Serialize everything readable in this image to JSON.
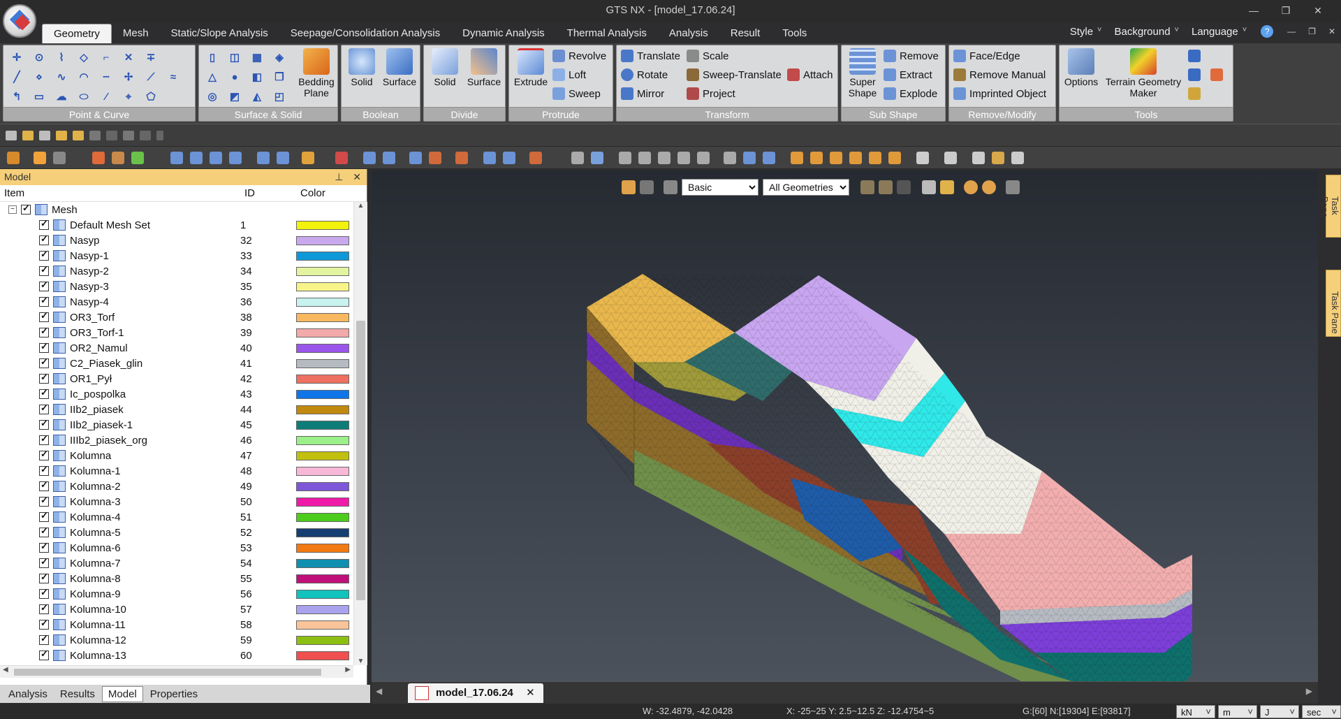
{
  "window": {
    "title": "GTS NX - [model_17.06.24]"
  },
  "menu": {
    "tabs": [
      "Geometry",
      "Mesh",
      "Static/Slope Analysis",
      "Seepage/Consolidation Analysis",
      "Dynamic Analysis",
      "Thermal Analysis",
      "Analysis",
      "Result",
      "Tools"
    ],
    "right": [
      "Style",
      "Background",
      "Language"
    ]
  },
  "ribbon": {
    "groups": {
      "point_curve": "Point & Curve",
      "surface_solid": "Surface & Solid",
      "boolean": "Boolean",
      "divide": "Divide",
      "protrude": "Protrude",
      "transform": "Transform",
      "sub_shape": "Sub Shape",
      "remove_modify": "Remove/Modify",
      "tools": "Tools"
    },
    "buttons": {
      "bedding": "Bedding Plane",
      "bool_solid": "Solid",
      "bool_surface": "Surface",
      "div_solid": "Solid",
      "div_surface": "Surface",
      "extrude": "Extrude",
      "revolve": "Revolve",
      "loft": "Loft",
      "sweep": "Sweep",
      "translate": "Translate",
      "rotate": "Rotate",
      "mirror": "Mirror",
      "scale": "Scale",
      "sweep_translate": "Sweep-Translate",
      "project": "Project",
      "attach": "Attach",
      "super_shape": "Super Shape",
      "remove": "Remove",
      "extract": "Extract",
      "explode": "Explode",
      "face_edge": "Face/Edge",
      "remove_manual": "Remove Manual",
      "imprinted_object": "Imprinted Object",
      "options": "Options",
      "terrain_maker": "Terrain Geometry Maker"
    }
  },
  "panel": {
    "title": "Model",
    "columns": {
      "item": "Item",
      "id": "ID",
      "color": "Color"
    },
    "root": "Mesh",
    "items": [
      {
        "name": "Default Mesh Set",
        "id": "1",
        "color": "#f2f20a"
      },
      {
        "name": "Nasyp",
        "id": "32",
        "color": "#c9a9ee"
      },
      {
        "name": "Nasyp-1",
        "id": "33",
        "color": "#0f98d8"
      },
      {
        "name": "Nasyp-2",
        "id": "34",
        "color": "#e3f4a0"
      },
      {
        "name": "Nasyp-3",
        "id": "35",
        "color": "#f7f58a"
      },
      {
        "name": "Nasyp-4",
        "id": "36",
        "color": "#c7f2ee"
      },
      {
        "name": "OR3_Torf",
        "id": "38",
        "color": "#f7b860"
      },
      {
        "name": "OR3_Torf-1",
        "id": "39",
        "color": "#f2a9a9"
      },
      {
        "name": "OR2_Namul",
        "id": "40",
        "color": "#9a55ea"
      },
      {
        "name": "C2_Piasek_glin",
        "id": "41",
        "color": "#b6bac2"
      },
      {
        "name": "OR1_Pył",
        "id": "42",
        "color": "#ee7060"
      },
      {
        "name": "Ic_pospolka",
        "id": "43",
        "color": "#1075e8"
      },
      {
        "name": "IIb2_piasek",
        "id": "44",
        "color": "#c0890f"
      },
      {
        "name": "IIb2_piasek-1",
        "id": "45",
        "color": "#0e7d78"
      },
      {
        "name": "IIIb2_piasek_org",
        "id": "46",
        "color": "#9cf089"
      },
      {
        "name": "Kolumna",
        "id": "47",
        "color": "#c2c00f"
      },
      {
        "name": "Kolumna-1",
        "id": "48",
        "color": "#f7b7d7"
      },
      {
        "name": "Kolumna-2",
        "id": "49",
        "color": "#7d57d8"
      },
      {
        "name": "Kolumna-3",
        "id": "50",
        "color": "#f01aa8"
      },
      {
        "name": "Kolumna-4",
        "id": "51",
        "color": "#4ccc1c"
      },
      {
        "name": "Kolumna-5",
        "id": "52",
        "color": "#163f72"
      },
      {
        "name": "Kolumna-6",
        "id": "53",
        "color": "#f27a12"
      },
      {
        "name": "Kolumna-7",
        "id": "54",
        "color": "#1090b0"
      },
      {
        "name": "Kolumna-8",
        "id": "55",
        "color": "#c0107a"
      },
      {
        "name": "Kolumna-9",
        "id": "56",
        "color": "#12c2bc"
      },
      {
        "name": "Kolumna-10",
        "id": "57",
        "color": "#a9a3ee"
      },
      {
        "name": "Kolumna-11",
        "id": "58",
        "color": "#f9c49a"
      },
      {
        "name": "Kolumna-12",
        "id": "59",
        "color": "#8cbf12"
      },
      {
        "name": "Kolumna-13",
        "id": "60",
        "color": "#f04f4f"
      }
    ]
  },
  "bottom_tabs": [
    "Analysis",
    "Results",
    "Model",
    "Properties"
  ],
  "viewport": {
    "view_mode": "Basic",
    "filter": "All Geometries (",
    "layers": {
      "orange_top": "#e8b74d",
      "brown": "#8d6b2b",
      "purple_left": "#6a2fb6",
      "olive": "#9f9a3a",
      "lilac_top": "#c8a6f0",
      "cyan": "#30e8e8",
      "white": "#f0f0e8",
      "pink": "#f2aeae",
      "purple_front": "#7c3fd8",
      "teal": "#0f6f6b",
      "green": "#6f8f4a",
      "sienna": "#8a3f2a",
      "blue": "#1f5ca8"
    }
  },
  "doc_tab": "model_17.06.24",
  "status": {
    "w": "W: -32.4879, -42.0428",
    "xyz": "X: -25~25 Y: 2.5~12.5 Z: -12.4754~5",
    "counts": "G:[60] N:[19304] E:[93817]",
    "units": [
      "kN",
      "m",
      "J",
      "sec"
    ]
  },
  "task_pane": "Task Pane"
}
